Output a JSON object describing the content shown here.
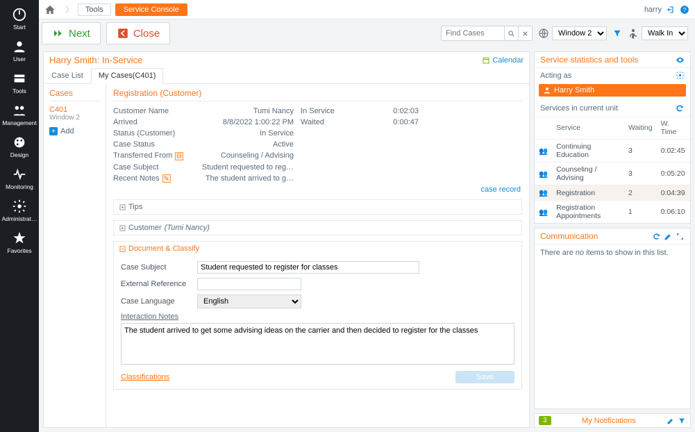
{
  "sidebar": {
    "items": [
      {
        "label": "Start"
      },
      {
        "label": "User"
      },
      {
        "label": "Tools"
      },
      {
        "label": "Management"
      },
      {
        "label": "Design"
      },
      {
        "label": "Monitoring"
      },
      {
        "label": "Administrat…"
      },
      {
        "label": "Favorites"
      }
    ]
  },
  "breadcrumb": {
    "tools": "Tools",
    "sc": "Service Console"
  },
  "user": {
    "name": "harry"
  },
  "actions": {
    "next": "Next",
    "close": "Close"
  },
  "find": {
    "placeholder": "Find Cases"
  },
  "topselect": {
    "window": "Window 2",
    "walkin": "Walk In"
  },
  "left": {
    "title": "Harry Smith: In-Service",
    "calendar": "Calendar",
    "tabs": {
      "list": "Case List",
      "my": "My Cases(C401)"
    },
    "cases": {
      "header": "Cases",
      "id": "C401",
      "win": "Window 2",
      "add": "Add"
    }
  },
  "reg": {
    "heading": "Registration (Customer)",
    "customer_name_l": "Customer Name",
    "customer_name": "Tumi Nancy",
    "arrived_l": "Arrived",
    "arrived": "8/8/2022 1:00:22 PM",
    "status_cust_l": "Status (Customer)",
    "status_cust": "In Service",
    "case_status_l": "Case Status",
    "case_status": "Active",
    "transferred_l": "Transferred From",
    "transferred": "Counseling / Advising",
    "subject_l": "Case Subject",
    "subject": "Student requested to reg…",
    "notes_l": "Recent Notes",
    "notes": "The student arrived to g…",
    "inservice_l": "In Service",
    "inservice": "0:02:03",
    "waited_l": "Waited",
    "waited": "0:00:47",
    "case_record": "case record"
  },
  "sections": {
    "tips": "Tips",
    "customer_prefix": "Customer ",
    "customer_name_em": "(Tumi Nancy)",
    "doc": "Document & Classify"
  },
  "form": {
    "subject_l": "Case Subject",
    "subject": "Student requested to register for classes",
    "extref_l": "External Reference",
    "extref": "",
    "lang_l": "Case Language",
    "lang": "English",
    "notes_l": "Interaction Notes",
    "notes": "The student arrived to get some advising ideas on the carrier and then decided to register for the classes",
    "class": "Classifications",
    "save": "Save"
  },
  "right": {
    "stats_title": "Service statistics and tools",
    "acting_as": "Acting as",
    "acting_name": "Harry Smith",
    "services_header": "Services in current unit",
    "table": {
      "cols": {
        "s": "Service",
        "w": "Waiting",
        "t": "W. Time"
      },
      "rows": [
        {
          "s": "Continuing Education",
          "w": "3",
          "t": "0:02:45"
        },
        {
          "s": "Counseling / Advising",
          "w": "3",
          "t": "0:05:20"
        },
        {
          "s": "Registration",
          "w": "2",
          "t": "0:04:39",
          "hl": true
        },
        {
          "s": "Registration Appointments",
          "w": "1",
          "t": "0:06:10"
        }
      ]
    },
    "comm_title": "Communication",
    "comm_empty": "There are no items to show in this list.",
    "notif": {
      "badge": "3",
      "label": "My Notifications"
    }
  }
}
